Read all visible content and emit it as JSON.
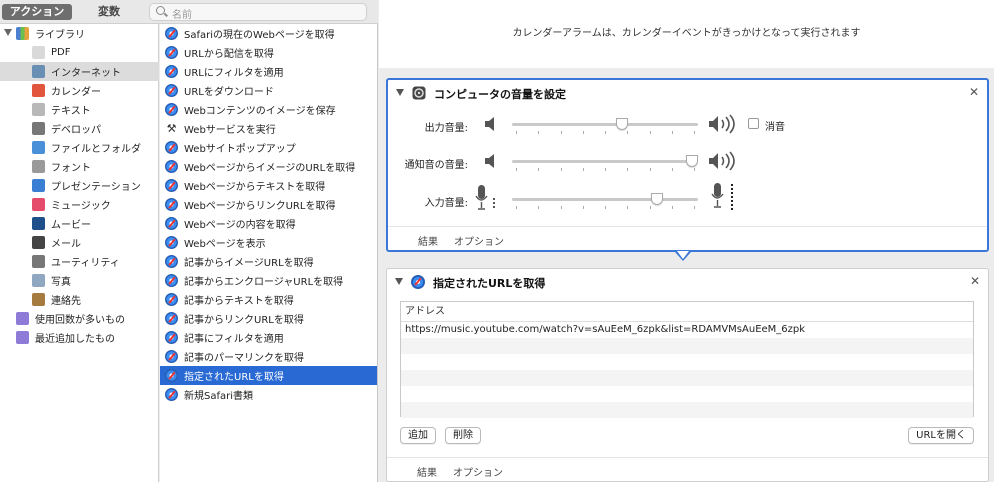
{
  "toolbar": {
    "actions_label": "アクション",
    "variables_label": "変数",
    "search_placeholder": "名前"
  },
  "library": {
    "root_label": "ライブラリ",
    "items": [
      {
        "label": "PDF",
        "icon": "pdf-icon",
        "color": "#d9d9d9"
      },
      {
        "label": "インターネット",
        "icon": "globe-icon",
        "color": "#6a8fb5",
        "selected": true
      },
      {
        "label": "カレンダー",
        "icon": "calendar-icon",
        "color": "#e2553d"
      },
      {
        "label": "テキスト",
        "icon": "text-icon",
        "color": "#b8b8b8"
      },
      {
        "label": "デベロッパ",
        "icon": "tools-icon",
        "color": "#777777"
      },
      {
        "label": "ファイルとフォルダ",
        "icon": "finder-icon",
        "color": "#4a90d9"
      },
      {
        "label": "フォント",
        "icon": "font-icon",
        "color": "#9a9a9a"
      },
      {
        "label": "プレゼンテーション",
        "icon": "keynote-icon",
        "color": "#3b7fd4"
      },
      {
        "label": "ミュージック",
        "icon": "music-icon",
        "color": "#e54c6c"
      },
      {
        "label": "ムービー",
        "icon": "quicktime-icon",
        "color": "#1f4f8a"
      },
      {
        "label": "メール",
        "icon": "mail-icon",
        "color": "#444444"
      },
      {
        "label": "ユーティリティ",
        "icon": "utility-icon",
        "color": "#777777"
      },
      {
        "label": "写真",
        "icon": "photos-icon",
        "color": "#8fa7c0"
      },
      {
        "label": "連絡先",
        "icon": "contacts-icon",
        "color": "#a57b3f"
      }
    ],
    "smart": [
      {
        "label": "使用回数が多いもの",
        "icon": "smart-folder-icon",
        "color": "#8e7bd8"
      },
      {
        "label": "最近追加したもの",
        "icon": "smart-folder-icon",
        "color": "#8e7bd8"
      }
    ]
  },
  "actions_list": [
    {
      "label": "Safariの現在のWebページを取得",
      "icon": "safari-icon"
    },
    {
      "label": "URLから配信を取得",
      "icon": "safari-icon"
    },
    {
      "label": "URLにフィルタを適用",
      "icon": "safari-icon"
    },
    {
      "label": "URLをダウンロード",
      "icon": "safari-icon"
    },
    {
      "label": "Webコンテンツのイメージを保存",
      "icon": "safari-icon"
    },
    {
      "label": "Webサービスを実行",
      "icon": "tools-icon"
    },
    {
      "label": "Webサイトポップアップ",
      "icon": "safari-icon"
    },
    {
      "label": "WebページからイメージのURLを取得",
      "icon": "safari-icon"
    },
    {
      "label": "Webページからテキストを取得",
      "icon": "safari-icon"
    },
    {
      "label": "WebページからリンクURLを取得",
      "icon": "safari-icon"
    },
    {
      "label": "Webページの内容を取得",
      "icon": "safari-icon"
    },
    {
      "label": "Webページを表示",
      "icon": "safari-icon"
    },
    {
      "label": "記事からイメージURLを取得",
      "icon": "safari-icon"
    },
    {
      "label": "記事からエンクロージャURLを取得",
      "icon": "safari-icon"
    },
    {
      "label": "記事からテキストを取得",
      "icon": "safari-icon"
    },
    {
      "label": "記事からリンクURLを取得",
      "icon": "safari-icon"
    },
    {
      "label": "記事にフィルタを適用",
      "icon": "safari-icon"
    },
    {
      "label": "記事のパーマリンクを取得",
      "icon": "safari-icon"
    },
    {
      "label": "指定されたURLを取得",
      "icon": "safari-icon",
      "selected": true
    },
    {
      "label": "新規Safari書類",
      "icon": "safari-icon"
    }
  ],
  "workflow": {
    "message": "カレンダーアラームは、カレンダーイベントがきっかけとなって実行されます",
    "volume_action": {
      "title": "コンピュータの音量を設定",
      "output_label": "出力音量:",
      "output_level": 0.6,
      "mute_label": "消音",
      "alert_label": "通知音の音量:",
      "alert_level": 1.0,
      "input_label": "入力音量:",
      "input_level": 0.8,
      "footer_results": "結果",
      "footer_options": "オプション"
    },
    "url_action": {
      "title": "指定されたURLを取得",
      "column_header": "アドレス",
      "urls": [
        "https://music.youtube.com/watch?v=sAuEeM_6zpk&list=RDAMVMsAuEeM_6zpk"
      ],
      "add_label": "追加",
      "delete_label": "削除",
      "open_label": "URLを開く",
      "footer_results": "結果",
      "footer_options": "オプション"
    }
  },
  "colors": {
    "selection_blue": "#2869d4",
    "active_border": "#3b77d6"
  }
}
